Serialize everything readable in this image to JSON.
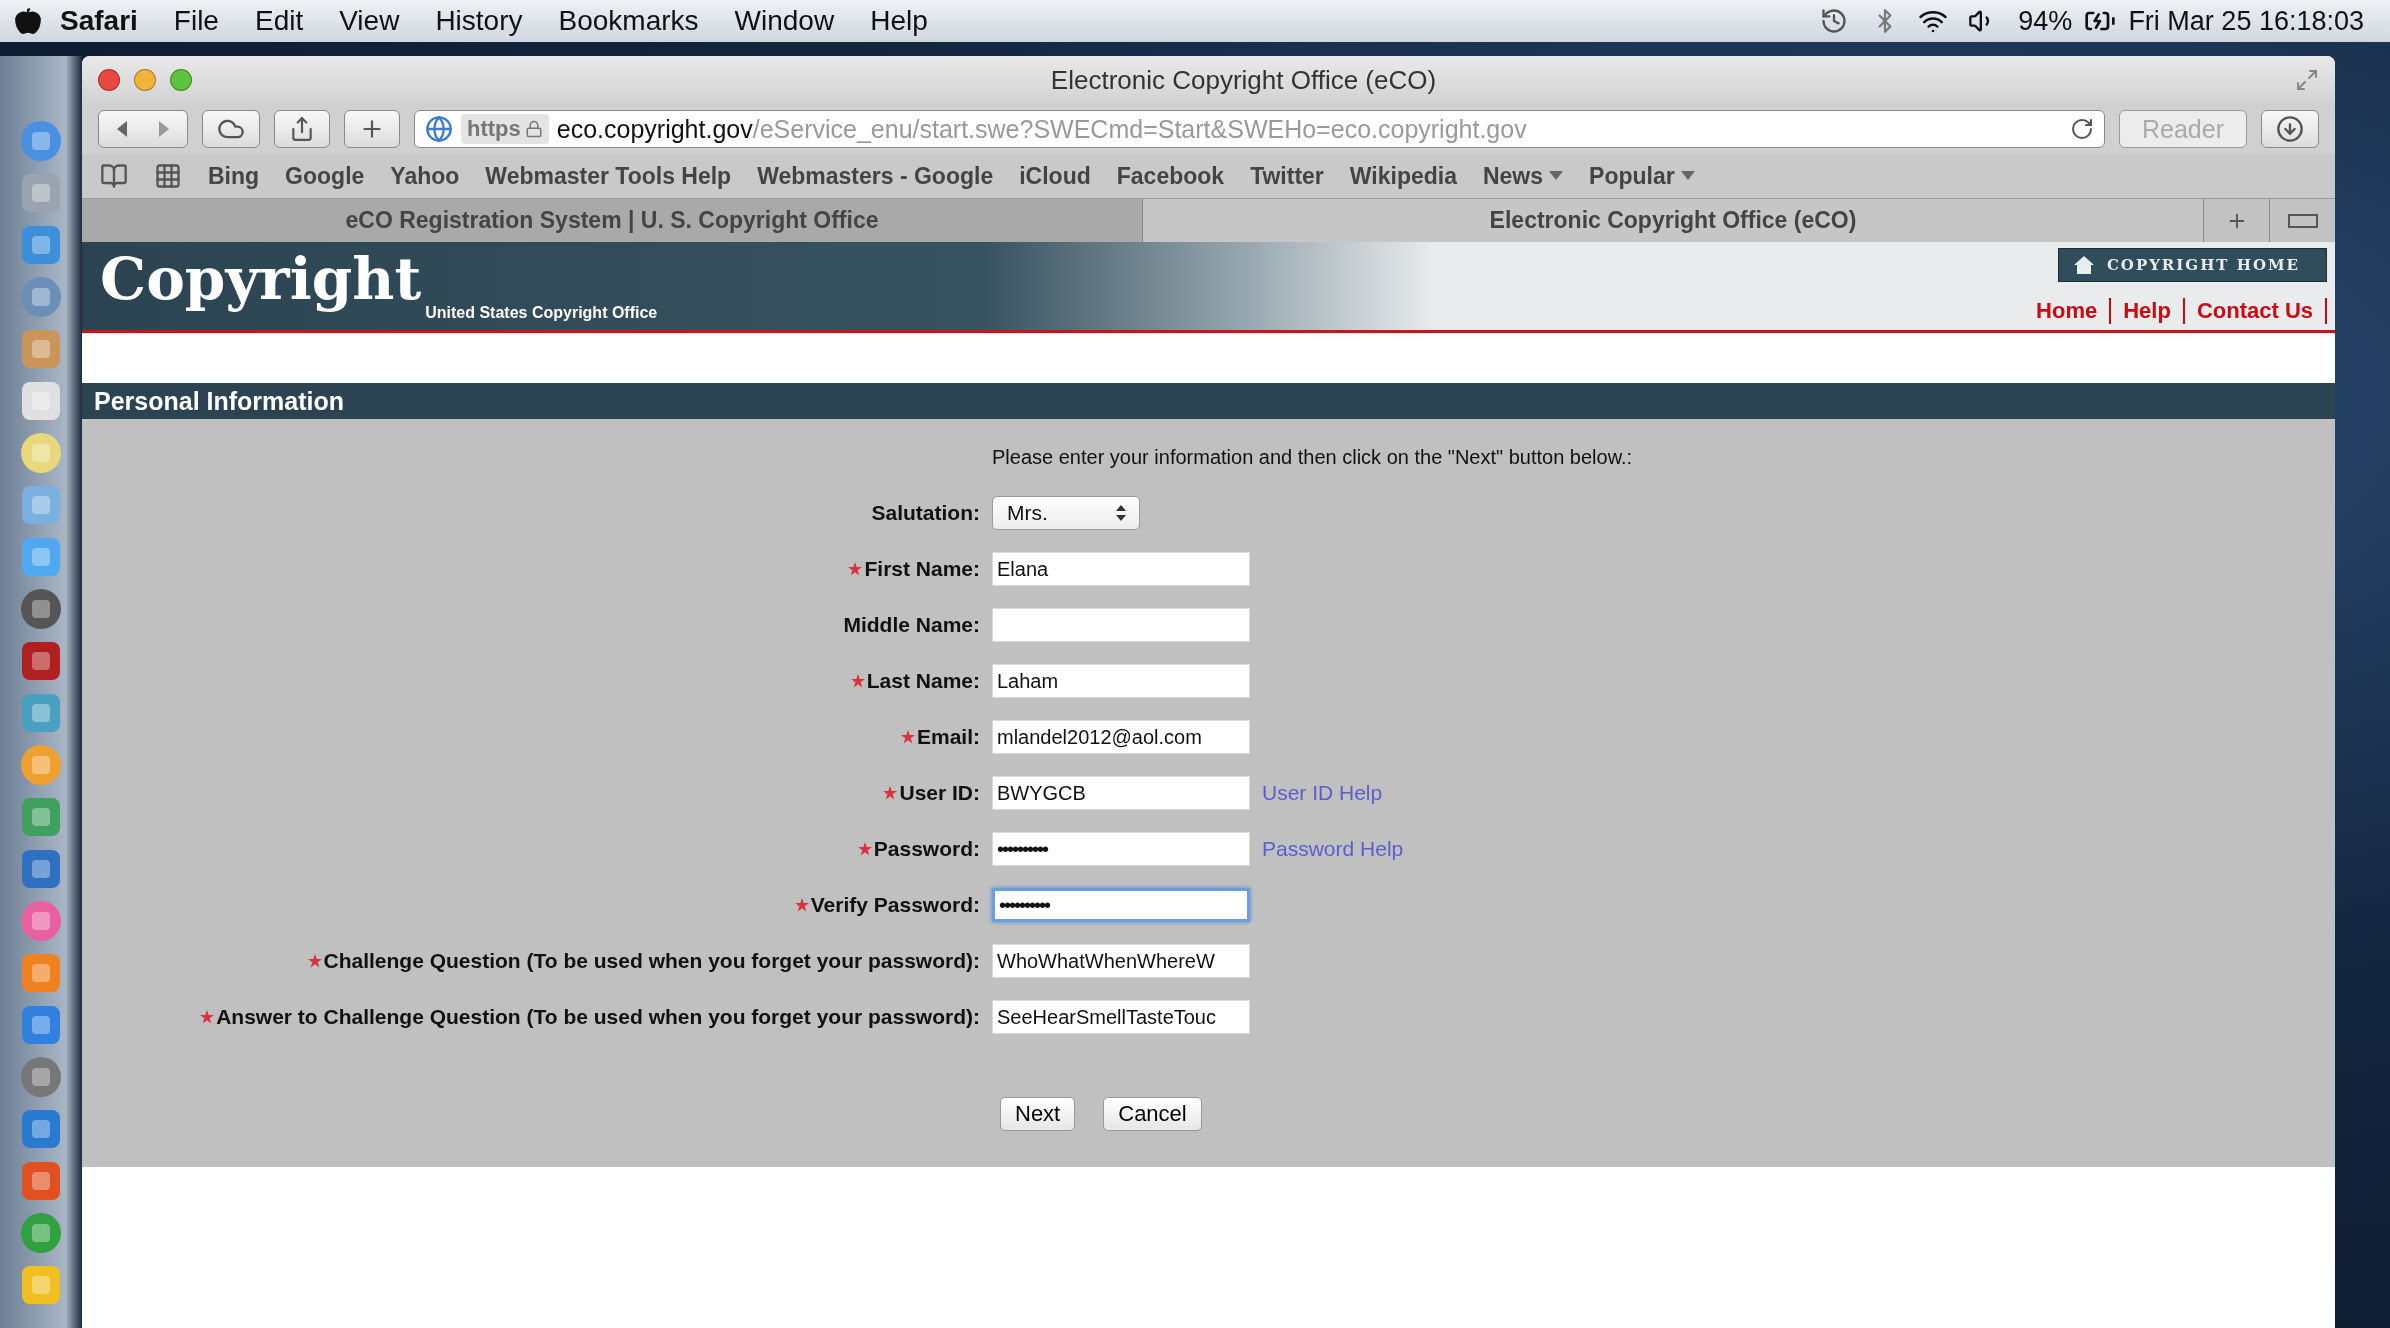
{
  "menu_bar": {
    "app": "Safari",
    "items": [
      "File",
      "Edit",
      "View",
      "History",
      "Bookmarks",
      "Window",
      "Help"
    ],
    "battery": "94%",
    "clock": "Fri Mar 25  16:18:03"
  },
  "browser": {
    "title": "Electronic Copyright Office (eCO)",
    "address": {
      "scheme": "https",
      "host": "eco.copyright.gov",
      "path": "/eService_enu/start.swe?SWECmd=Start&SWEHo=eco.copyright.gov"
    },
    "reader": "Reader",
    "bookmarks": [
      {
        "label": "Bing",
        "menu": false
      },
      {
        "label": "Google",
        "menu": false
      },
      {
        "label": "Yahoo",
        "menu": false
      },
      {
        "label": "Webmaster Tools Help",
        "menu": false
      },
      {
        "label": "Webmasters - Google",
        "menu": false
      },
      {
        "label": "iCloud",
        "menu": false
      },
      {
        "label": "Facebook",
        "menu": false
      },
      {
        "label": "Twitter",
        "menu": false
      },
      {
        "label": "Wikipedia",
        "menu": false
      },
      {
        "label": "News",
        "menu": true
      },
      {
        "label": "Popular",
        "menu": true
      }
    ],
    "tabs": [
      {
        "label": "eCO Registration System | U. S. Copyright Office",
        "selected": false
      },
      {
        "label": "Electronic Copyright Office (eCO)",
        "selected": true
      }
    ]
  },
  "page": {
    "header": {
      "logo": "Copyright",
      "subtitle": "United States Copyright Office",
      "home_button": "COPYRIGHT HOME",
      "links": [
        "Home",
        "Help",
        "Contact Us"
      ]
    },
    "section_title": "Personal Information",
    "instruction": "Please enter your information and then click on the \"Next\" button below.:",
    "fields": [
      {
        "kind": "select",
        "label": "Salutation:",
        "required": false,
        "value": "Mrs.",
        "focused": false
      },
      {
        "kind": "text",
        "label": "First Name:",
        "required": true,
        "value": "Elana",
        "focused": false
      },
      {
        "kind": "text",
        "label": "Middle Name:",
        "required": false,
        "focused": false
      },
      {
        "kind": "text",
        "label": "Last Name:",
        "required": true,
        "value": "Laham",
        "focused": false
      },
      {
        "kind": "text",
        "label": "Email:",
        "required": true,
        "value": "mlandel2012@aol.com",
        "focused": false
      },
      {
        "kind": "text",
        "label": "User ID:",
        "required": true,
        "value": "BWYGCB",
        "focused": false,
        "help": "User ID Help"
      },
      {
        "kind": "password",
        "label": "Password:",
        "required": true,
        "value": "••••••••••",
        "focused": false,
        "help": "Password Help"
      },
      {
        "kind": "password",
        "label": "Verify Password:",
        "required": true,
        "value": "••••••••••",
        "focused": true
      },
      {
        "kind": "text",
        "label": "Challenge Question (To be used when you forget your password):",
        "required": true,
        "value": "WhoWhatWhenWhereW",
        "focused": false
      },
      {
        "kind": "text",
        "label": "Answer to Challenge Question (To be used when you forget your password):",
        "required": true,
        "value": "SeeHearSmellTasteTouc",
        "focused": false
      }
    ],
    "buttons": [
      "Next",
      "Cancel"
    ]
  }
}
